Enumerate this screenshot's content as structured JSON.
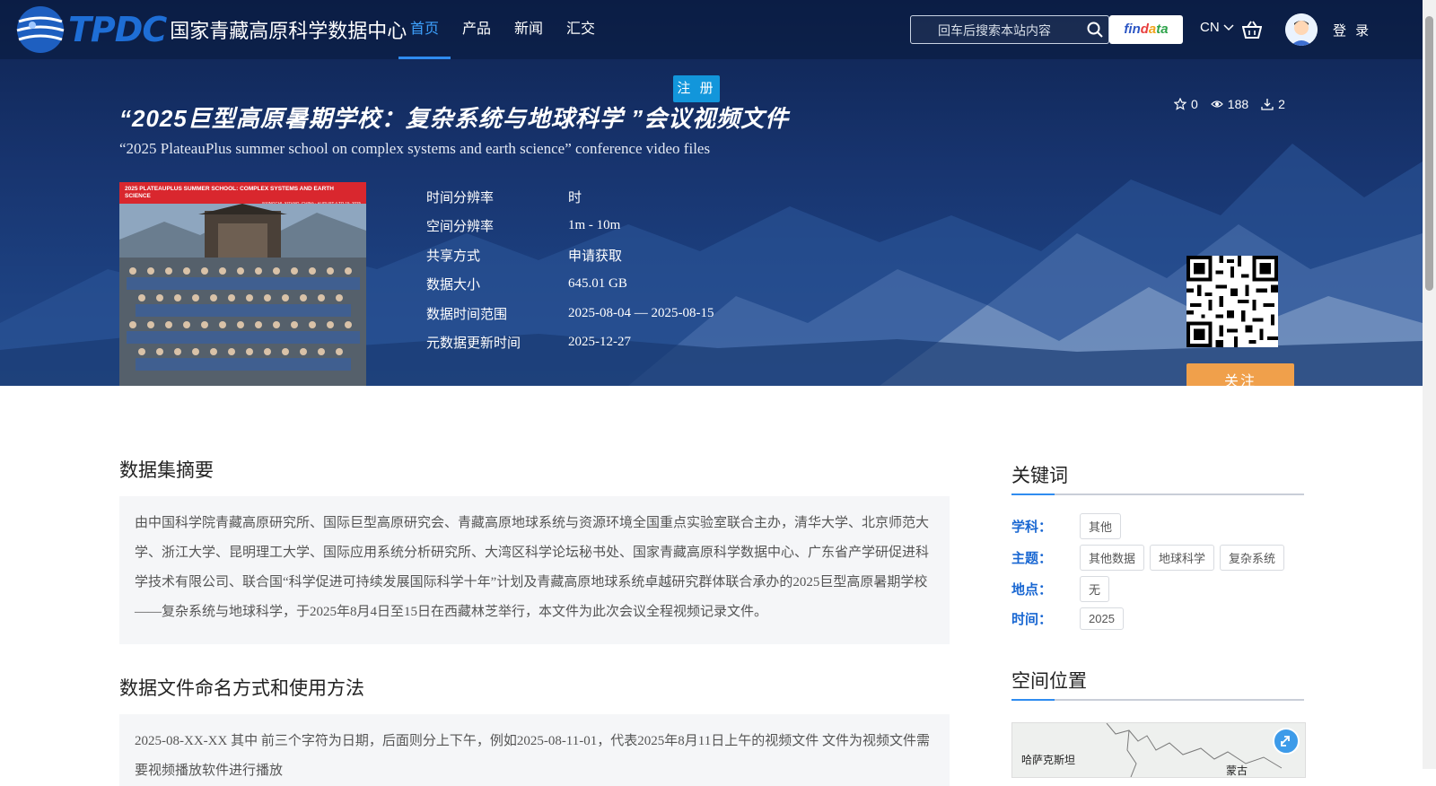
{
  "header": {
    "logo_text": "TPDC",
    "site_name": "国家青藏高原科学数据中心",
    "nav": [
      {
        "label": "首页",
        "active": true
      },
      {
        "label": "产品",
        "active": false
      },
      {
        "label": "新闻",
        "active": false
      },
      {
        "label": "汇交",
        "active": false
      }
    ],
    "search_placeholder": "回车后搜索本站内容",
    "findata": {
      "p1": "fin",
      "p2": "d",
      "p3": "a",
      "p4": "ta"
    },
    "lang": "CN",
    "login": "登 录",
    "register": "注 册"
  },
  "dataset": {
    "title_cn": "“2025巨型高原暑期学校：复杂系统与地球科学 ”会议视频文件",
    "title_en": "“2025 PlateauPlus summer school on complex systems and earth science” conference video files",
    "stats": {
      "stars": "0",
      "views": "188",
      "downloads": "2"
    },
    "image_banner": "2025 PLATEAUPLUS SUMMER SCHOOL: COMPLEX SYSTEMS AND EARTH SCIENCE",
    "image_banner_sub": "NYINGCHI, XIZANG, CHINA · AUGUST 4 TO 15, 2025",
    "meta": [
      {
        "key": "时间分辨率",
        "value": "时"
      },
      {
        "key": "空间分辨率",
        "value": "1m - 10m"
      },
      {
        "key": "共享方式",
        "value": "申请获取"
      },
      {
        "key": "数据大小",
        "value": "645.01 GB"
      },
      {
        "key": "数据时间范围",
        "value": "2025-08-04 — 2025-08-15"
      },
      {
        "key": "元数据更新时间",
        "value": "2025-12-27"
      }
    ],
    "follow": "关注"
  },
  "main": {
    "summary_title": "数据集摘要",
    "summary_text": "由中国科学院青藏高原研究所、国际巨型高原研究会、青藏高原地球系统与资源环境全国重点实验室联合主办，清华大学、北京师范大学、浙江大学、昆明理工大学、国际应用系统分析研究所、大湾区科学论坛秘书处、国家青藏高原科学数据中心、广东省产学研促进科学技术有限公司、联合国“科学促进可持续发展国际科学十年”计划及青藏高原地球系统卓越研究群体联合承办的2025巨型高原暑期学校——复杂系统与地球科学，于2025年8月4日至15日在西藏林芝举行，本文件为此次会议全程视频记录文件。",
    "usage_title": "数据文件命名方式和使用方法",
    "usage_text": "2025-08-XX-XX 其中 前三个字符为日期，后面则分上下午，例如2025-08-11-01，代表2025年8月11日上午的视频文件 文件为视频文件需要视频播放软件进行播放"
  },
  "sidebar": {
    "keywords_title": "关键词",
    "rows": [
      {
        "label": "学科：",
        "tags": [
          "其他"
        ]
      },
      {
        "label": "主题：",
        "tags": [
          "其他数据",
          "地球科学",
          "复杂系统"
        ]
      },
      {
        "label": "地点：",
        "tags": [
          "无"
        ]
      },
      {
        "label": "时间：",
        "tags": [
          "2025"
        ]
      }
    ],
    "location_title": "空间位置",
    "map_label_1": "哈萨克斯坦",
    "map_label_2": "蒙古"
  }
}
